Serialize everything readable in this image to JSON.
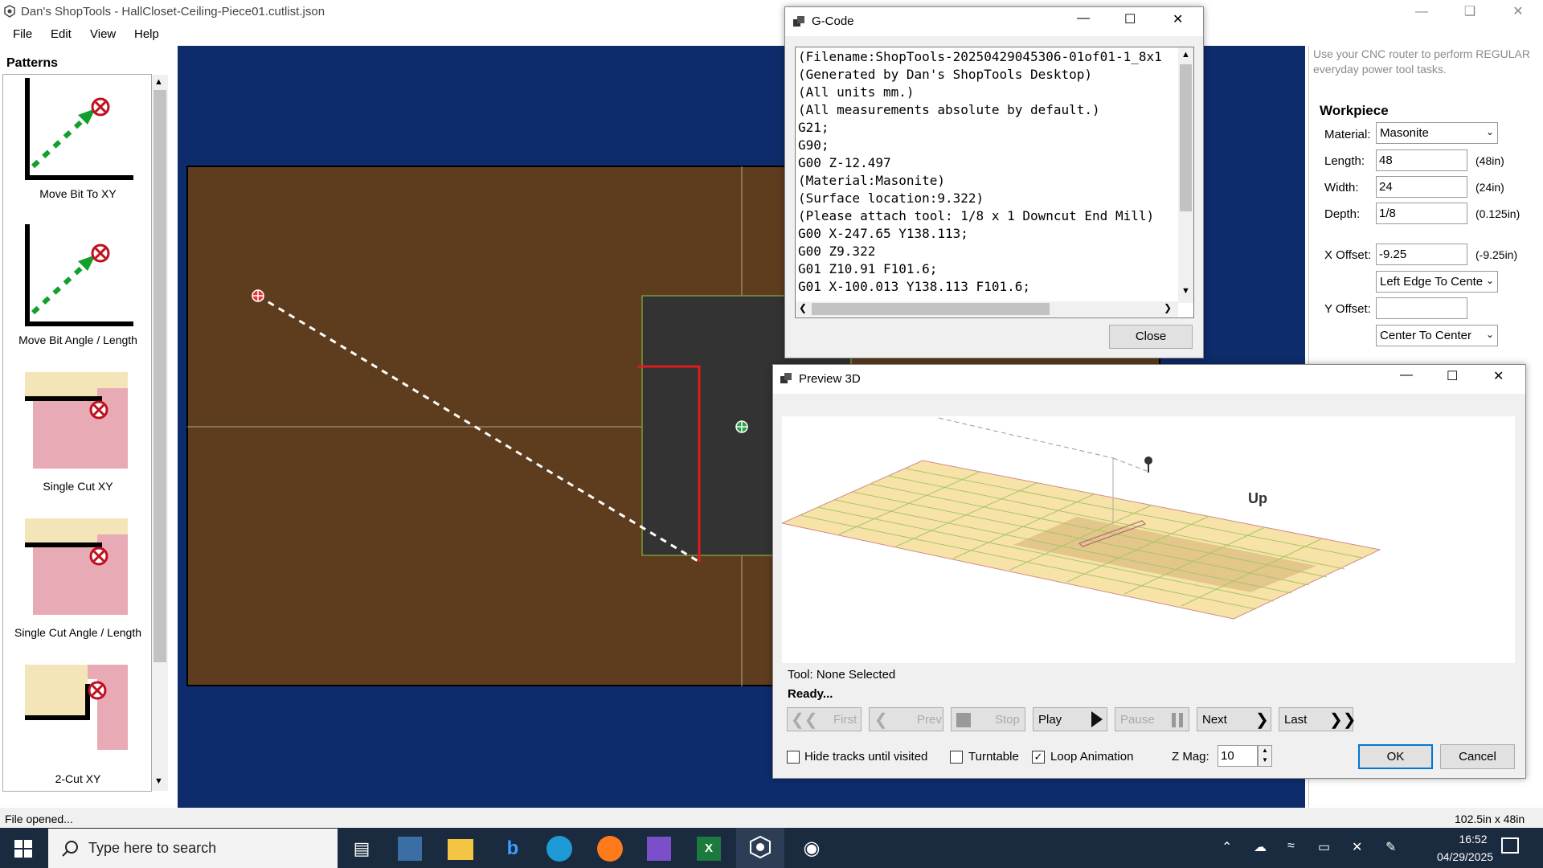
{
  "window": {
    "title": "Dan's ShopTools - HallCloset-Ceiling-Piece01.cutlist.json"
  },
  "menu": [
    "File",
    "Edit",
    "View",
    "Help"
  ],
  "patterns": {
    "title": "Patterns",
    "items": [
      {
        "label": "Move Bit To XY",
        "icon": "move-bit-xy-icon"
      },
      {
        "label": "Move Bit Angle / Length",
        "icon": "move-bit-angle-icon"
      },
      {
        "label": "Single Cut XY",
        "icon": "single-cut-xy-icon"
      },
      {
        "label": "Single Cut Angle / Length",
        "icon": "single-cut-angle-icon"
      },
      {
        "label": "2-Cut XY",
        "icon": "two-cut-xy-icon"
      }
    ]
  },
  "right_panel": {
    "hint": "Use your CNC router to perform REGULAR everyday power tool tasks.",
    "workpiece_title": "Workpiece",
    "material_label": "Material:",
    "material_value": "Masonite",
    "length_label": "Length:",
    "length_value": "48",
    "length_hint": "(48in)",
    "width_label": "Width:",
    "width_value": "24",
    "width_hint": "(24in)",
    "depth_label": "Depth:",
    "depth_value": "1/8",
    "depth_hint": "(0.125in)",
    "xoffset_label": "X Offset:",
    "xoffset_value": "-9.25",
    "xoffset_hint": "(-9.25in)",
    "xoffset_mode": "Left Edge To Cente",
    "yoffset_label": "Y Offset:",
    "yoffset_value": "",
    "yoffset_mode": "Center To Center"
  },
  "status": {
    "left": "File opened...",
    "right": "102.5in x 48in"
  },
  "gcode": {
    "title": "G-Code",
    "lines": [
      "(Filename:ShopTools-20250429045306-01of01-1_8x1",
      "(Generated by Dan's ShopTools Desktop)",
      "(All units mm.)",
      "(All measurements absolute by default.)",
      "G21;",
      "G90;",
      "G00 Z-12.497",
      "(Material:Masonite)",
      "(Surface location:9.322)",
      "(Please attach tool: 1/8 x 1 Downcut End Mill)",
      "G00 X-247.65 Y138.113;",
      "G00 Z9.322",
      "G01 Z10.91 F101.6;",
      "G01 X-100.013 Y138.113 F101.6;"
    ],
    "close_label": "Close"
  },
  "preview": {
    "title": "Preview 3D",
    "up_label": "Up",
    "tool_text": "Tool: None Selected",
    "ready_text": "Ready...",
    "buttons": {
      "first": "First",
      "prev": "Prev",
      "stop": "Stop",
      "play": "Play",
      "pause": "Pause",
      "next": "Next",
      "last": "Last"
    },
    "hide_tracks_label": "Hide tracks until visited",
    "hide_tracks_checked": false,
    "turntable_label": "Turntable",
    "turntable_checked": false,
    "loop_label": "Loop Animation",
    "loop_checked": true,
    "zmag_label": "Z Mag:",
    "zmag_value": "10",
    "ok_label": "OK",
    "cancel_label": "Cancel"
  },
  "taskbar": {
    "search_placeholder": "Type here to search",
    "time": "16:52",
    "date": "04/29/2025"
  }
}
